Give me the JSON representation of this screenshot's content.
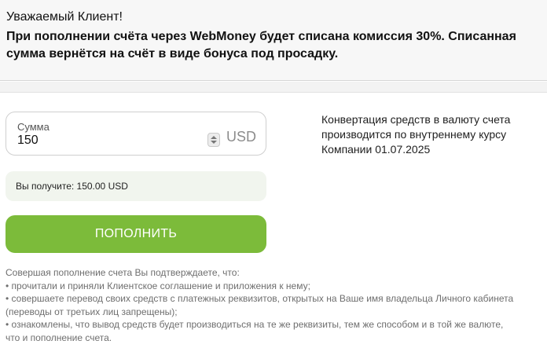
{
  "notice": {
    "greeting": "Уважаемый Клиент!",
    "text": "При пополнении счёта через WebMoney будет списана комиссия 30%. Списанная сумма вернётся на счёт в виде бонуса под просадку."
  },
  "form": {
    "amount_label": "Сумма",
    "amount_value": "150",
    "currency": "USD",
    "receive_text": "Вы получите: 150.00 USD",
    "submit_label": "ПОПОЛНИТЬ"
  },
  "conversion_note": "Конвертация средств в валюту счета производится по внутреннему курсу Компании 01.07.2025",
  "terms": {
    "intro": "Совершая пополнение счета Вы подтверждаете, что:",
    "items": [
      "• прочитали и приняли Клиентское соглашение и приложения к нему;",
      "• совершаете перевод своих средств с платежных реквизитов, открытых на Ваше имя владельца Личного кабинета (переводы от третьих лиц запрещены);",
      "• ознакомлены, что вывод средств будет производиться на те же реквизиты, тем же способом и в той же валюте, что и пополнение счета."
    ]
  },
  "colors": {
    "button": "#7cbb3a",
    "receive_bg": "#f1f5ee",
    "notice_bg": "#f7f7f7"
  },
  "icons": {
    "stepper": "number-stepper-icon"
  }
}
